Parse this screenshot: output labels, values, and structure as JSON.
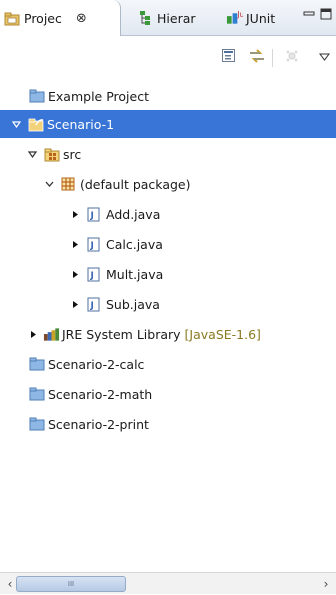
{
  "tabs": [
    {
      "label": "Projec",
      "close": "⊗"
    },
    {
      "label": "Hierar"
    },
    {
      "label": "JUnit"
    }
  ],
  "tree": {
    "example_project": "Example Project",
    "scenario1": "Scenario-1",
    "src": "src",
    "default_package": "(default package)",
    "files": [
      "Add.java",
      "Calc.java",
      "Mult.java",
      "Sub.java"
    ],
    "jre": "JRE System Library",
    "jre_decoration": "[JavaSE-1.6]",
    "scenario2_calc": "Scenario-2-calc",
    "scenario2_math": "Scenario-2-math",
    "scenario2_print": "Scenario-2-print"
  },
  "scrollbar": {
    "left_arrow": "‹",
    "right_arrow": "›",
    "grip": "III"
  },
  "colors": {
    "selection": "#3875d7",
    "folder": "#8fb7e6",
    "package_brown": "#b8651c",
    "decoration": "#8a7a22"
  }
}
